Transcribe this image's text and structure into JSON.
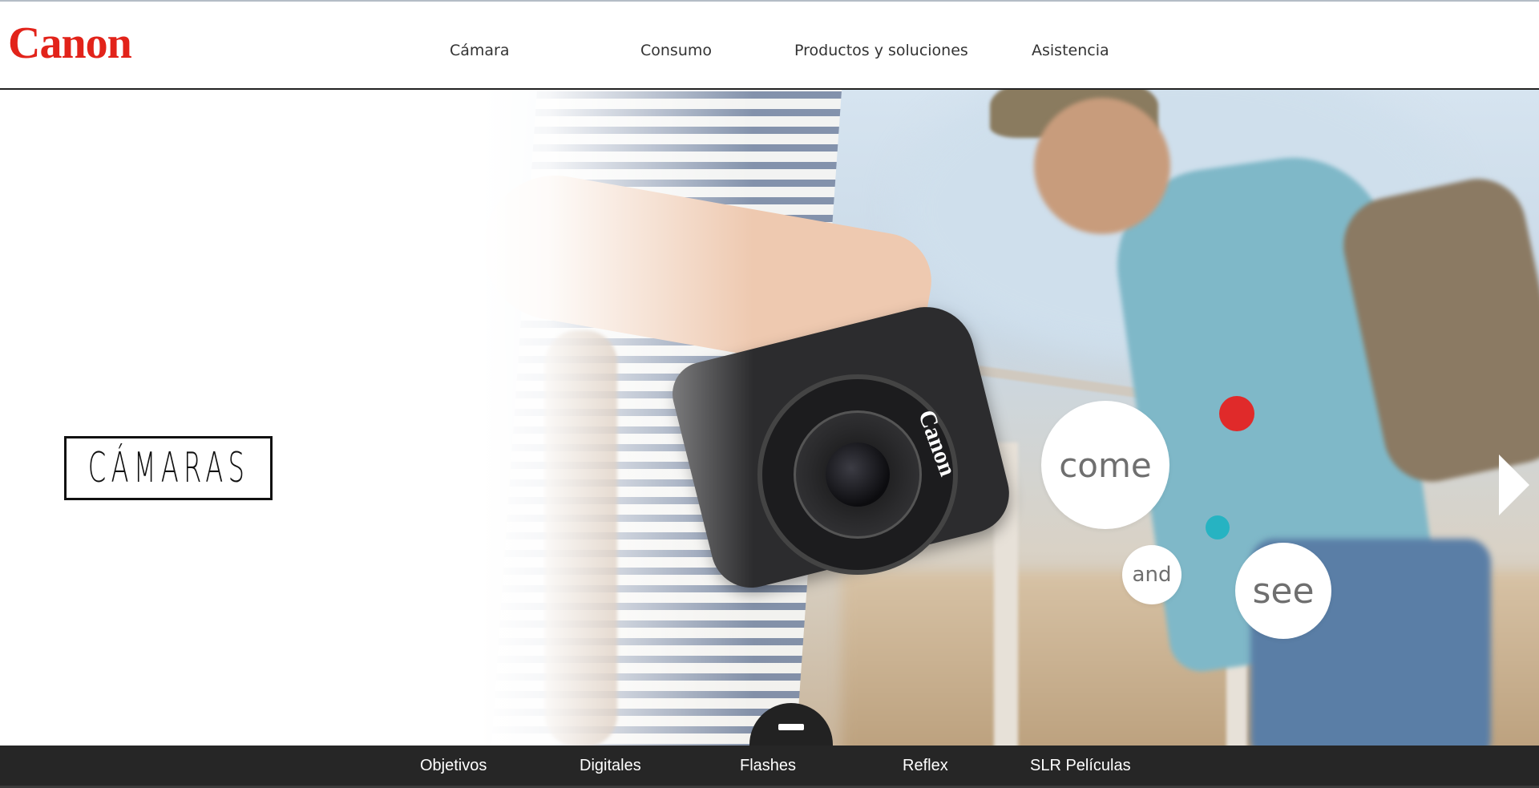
{
  "header": {
    "logo_text": "Canon",
    "nav": [
      "Cámara",
      "Consumo",
      "Productos y soluciones",
      "Asistencia"
    ]
  },
  "hero": {
    "title": "CÁMARAS",
    "camera_brand": "Canon",
    "bubbles": [
      "come",
      "and",
      "see"
    ],
    "next_icon": "chevron-right-icon"
  },
  "categories": [
    "Objetivos",
    "Digitales",
    "Flashes",
    "Reflex",
    "SLR Películas"
  ],
  "colors": {
    "brand": "#e2231a",
    "bottom_bar": "#262626",
    "red_dot": "#e02a2a",
    "teal_dot": "#26b3c2"
  }
}
